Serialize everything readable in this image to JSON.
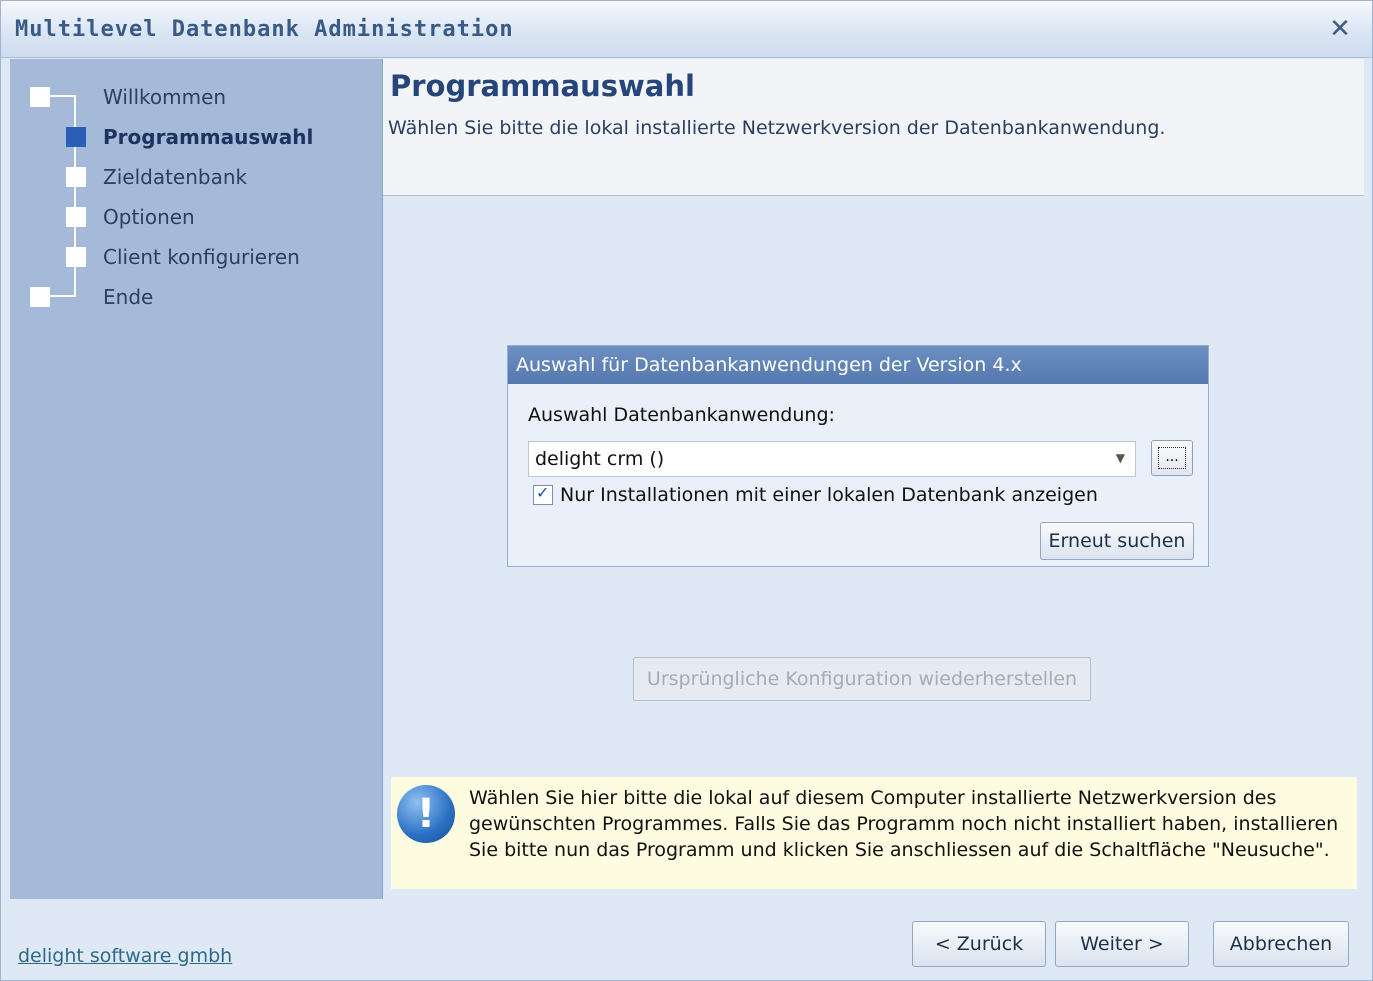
{
  "window": {
    "title": "Multilevel Datenbank Administration",
    "close_glyph": "✕"
  },
  "steps": [
    {
      "label": "Willkommen",
      "active": false
    },
    {
      "label": "Programmauswahl",
      "active": true
    },
    {
      "label": "Zieldatenbank",
      "active": false
    },
    {
      "label": "Optionen",
      "active": false
    },
    {
      "label": "Client konfigurieren",
      "active": false
    },
    {
      "label": "Ende",
      "active": false
    }
  ],
  "header": {
    "title": "Programmauswahl",
    "subtitle": "Wählen Sie bitte die lokal installierte Netzwerkversion der Datenbankanwendung."
  },
  "group": {
    "title": "Auswahl für Datenbankanwendungen der Version 4.x",
    "field_label": "Auswahl Datenbankanwendung:",
    "selected_value": "delight crm ()",
    "browse_label": "...",
    "checkbox_label": "Nur Installationen mit einer lokalen Datenbank anzeigen",
    "checkbox_checked": true,
    "search_again_label": "Erneut suchen"
  },
  "restore_label": "Ursprüngliche Konfiguration wiederherstellen",
  "info": {
    "text": "Wählen Sie hier bitte die lokal auf diesem Computer installierte Netzwerkversion des gewünschten Programmes. Falls Sie das Programm noch nicht installiert haben, installieren Sie bitte nun das Programm und klicken Sie anschliessen auf die Schaltfläche \"Neusuche\".",
    "icon": "!"
  },
  "footer": {
    "company_link": "delight software gmbh",
    "back_label": "< Zurück",
    "next_label": "Weiter >",
    "cancel_label": "Abbrechen"
  }
}
